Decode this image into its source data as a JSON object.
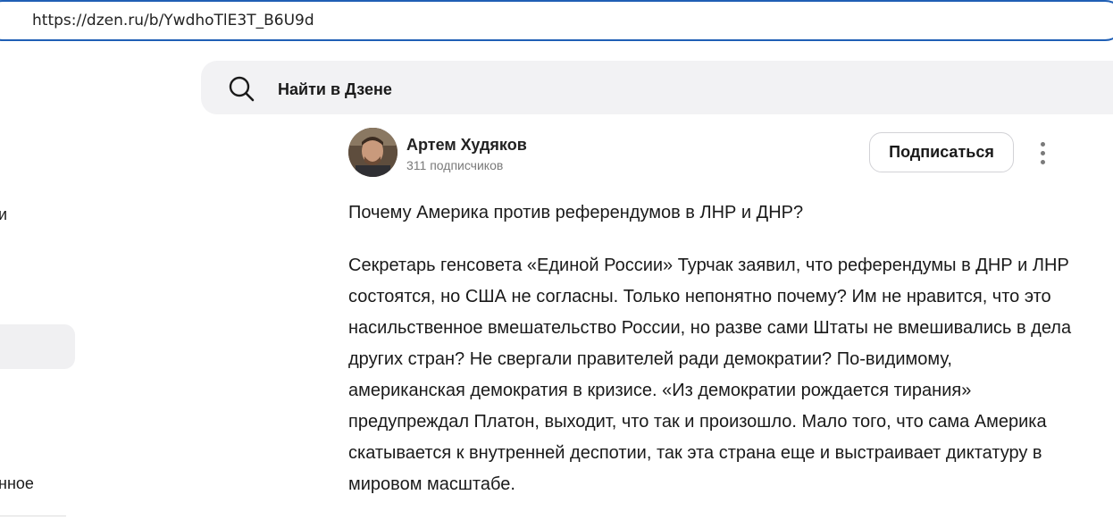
{
  "browser": {
    "url": "https://dzen.ru/b/YwdhoTlE3T_B6U9d"
  },
  "sidebar": {
    "fragment_1": "и",
    "fragment_2": "нное"
  },
  "search": {
    "placeholder": "Найти в Дзене"
  },
  "author": {
    "name": "Артем Худяков",
    "subscribers": "311 подписчиков",
    "subscribe_label": "Подписаться"
  },
  "article": {
    "title": "Почему Америка против референдумов в ЛНР и ДНР?",
    "body": "Секретарь генсовета «Единой России» Турчак заявил, что референдумы в ДНР и ЛНР состоятся, но США не согласны. Только непонятно почему? Им не нравится, что это насильственное вмешательство России, но разве сами Штаты не вмешивались в дела других стран? Не свергали правителей ради демократии? По-видимому, американская демократия в кризисе. «Из демократии рождается тирания» предупреждал Платон, выходит, что так и произошло.  Мало того, что сама Америка скатывается к внутренней деспотии, так эта страна еще и выстраивает диктатуру в мировом масштабе."
  }
}
